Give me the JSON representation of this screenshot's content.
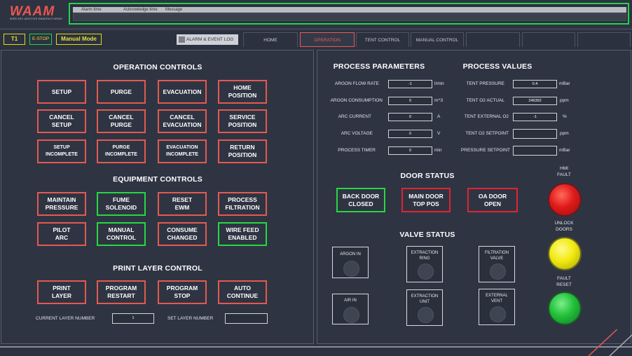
{
  "header": {
    "logo_text": "WAAM",
    "logo_sub": "WIRE ARC ADDITIVE MANUFACTURING",
    "alarm_cols": [
      "Alarm time",
      "Acknowledge time",
      "Message"
    ]
  },
  "nav": {
    "t1": "T1",
    "estop": "E-STOP",
    "mode": "Manual Mode",
    "alarm_log": "ALARM & EVENT LOG",
    "tabs": [
      "HOME",
      "OPERATION",
      "TENT CONTROL",
      "MANUAL CONTROL",
      "",
      "",
      "",
      ""
    ]
  },
  "left": {
    "op_title": "OPERATION CONTROLS",
    "op_buttons": [
      [
        "SETUP"
      ],
      [
        "PURGE"
      ],
      [
        "EVACUATION"
      ],
      [
        "HOME",
        "POSITION"
      ],
      [
        "CANCEL",
        "SETUP"
      ],
      [
        "CANCEL",
        "PURGE"
      ],
      [
        "CANCEL",
        "EVACUATION"
      ],
      [
        "SERVICE",
        "POSITION"
      ],
      [
        "SETUP",
        "INCOMPLETE"
      ],
      [
        "PURGE",
        "INCOMPLETE"
      ],
      [
        "EVACUATION",
        "INCOMPLETE"
      ],
      [
        "RETURN",
        "POSITION"
      ]
    ],
    "eq_title": "EQUIPMENT CONTROLS",
    "eq_buttons": [
      [
        "MAINTAIN",
        "PRESSURE"
      ],
      [
        "FUME",
        "SOLENOID"
      ],
      [
        "RESET",
        "EWM"
      ],
      [
        "PROCESS",
        "FILTRATION"
      ],
      [
        "PILOT",
        "ARC"
      ],
      [
        "MANUAL",
        "CONTROL"
      ],
      [
        "CONSUME",
        "CHANGED"
      ],
      [
        "WIRE FEED",
        "ENABLED"
      ]
    ],
    "print_title": "PRINT LAYER CONTROL",
    "print_buttons": [
      [
        "PRINT",
        "LAYER"
      ],
      [
        "PROGRAM",
        "RESTART"
      ],
      [
        "PROGRAM",
        "STOP"
      ],
      [
        "AUTO",
        "CONTINUE"
      ]
    ],
    "current_layer_label": "CURRENT LAYER NUMBER",
    "current_layer_value": "1",
    "set_layer_label": "SET LAYER NUMBER",
    "set_layer_value": ""
  },
  "right": {
    "pp_title": "PROCESS PARAMETERS",
    "pp": [
      {
        "label": "ARGON FLOW RATE",
        "value": "-1",
        "unit": "l/min"
      },
      {
        "label": "ARGON CONSUMPTION",
        "value": "0",
        "unit": "m^3"
      },
      {
        "label": "ARC CURRENT",
        "value": "0",
        "unit": "A"
      },
      {
        "label": "ARC VOLTAGE",
        "value": "0",
        "unit": "V"
      },
      {
        "label": "PROCESS TIMER",
        "value": "0",
        "unit": "min"
      }
    ],
    "pv_title": "PROCESS VALUES",
    "pv": [
      {
        "label": "TENT PRESSURE",
        "value": "0.4",
        "unit": "mBar"
      },
      {
        "label": "TENT O2 ACTUAL",
        "value": "249392",
        "unit": "ppm"
      },
      {
        "label": "TENT EXTERNAL O2",
        "value": "-1",
        "unit": "%"
      },
      {
        "label": "TENT O2 SETPOINT",
        "value": "",
        "unit": "ppm"
      },
      {
        "label": "PRESSURE SETPOINT",
        "value": "",
        "unit": "mBar"
      }
    ],
    "door_title": "DOOR STATUS",
    "doors": [
      [
        "BACK DOOR",
        "CLOSED"
      ],
      [
        "MAIN DOOR",
        "TOP POS"
      ],
      [
        "OA DOOR",
        "OPEN"
      ]
    ],
    "valve_title": "VALVE STATUS",
    "valves": [
      [
        "ARGON IN"
      ],
      [
        "EXTRACTION",
        "RING"
      ],
      [
        "FILTRATION",
        "VALVE"
      ],
      [
        "AIR IN"
      ],
      [
        "EXTRACTION",
        "UNIT"
      ],
      [
        "EXTERNAL",
        "VENT"
      ]
    ],
    "lamps": [
      {
        "label": [
          "HMI",
          "FAULT"
        ],
        "color": "#e01a1a"
      },
      {
        "label": [
          "UNLOCK",
          "DOORS"
        ],
        "color": "#f2ea10"
      },
      {
        "label": [
          "FAULT",
          "RESET"
        ],
        "color": "#22c03a"
      }
    ]
  }
}
